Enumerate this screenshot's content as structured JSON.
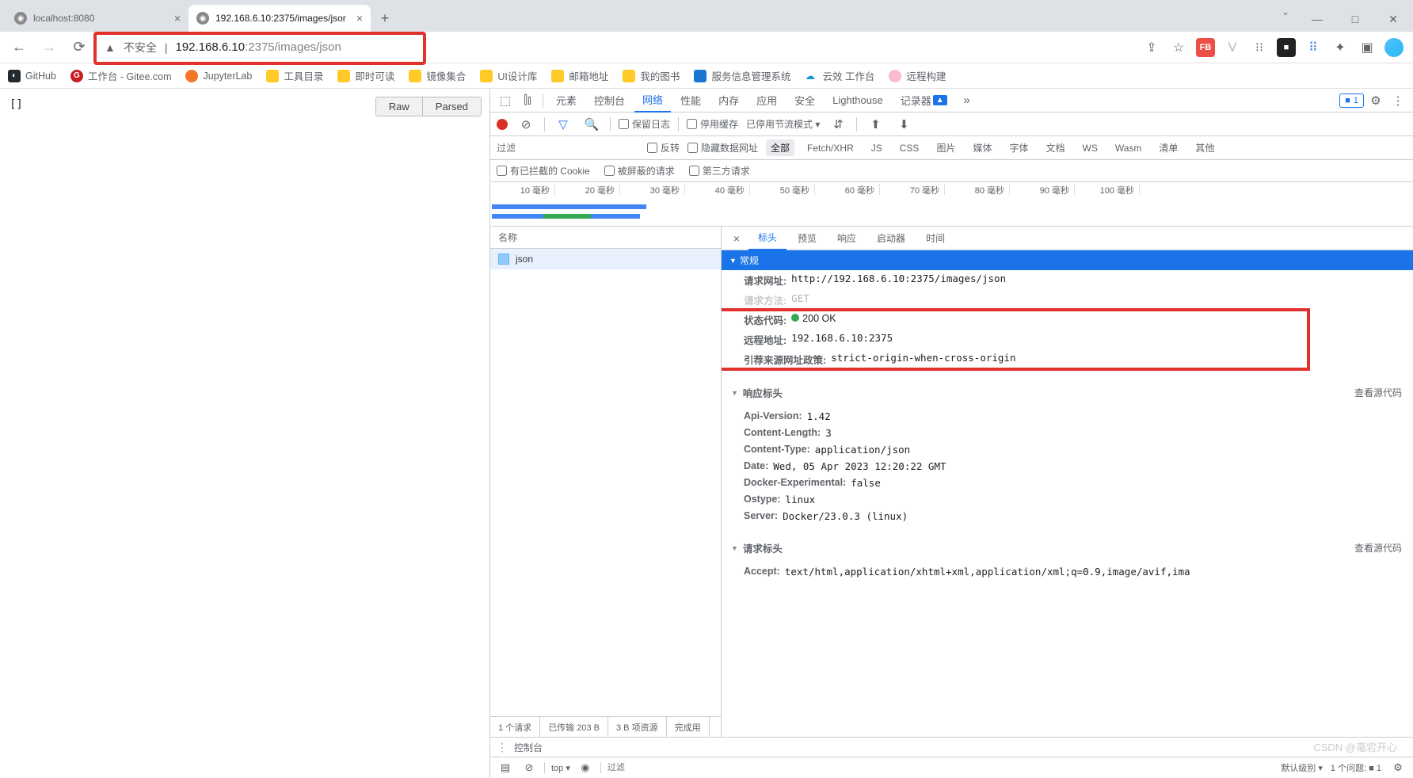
{
  "tabs": [
    {
      "title": "localhost:8080",
      "active": false
    },
    {
      "title": "192.168.6.10:2375/images/jsor",
      "active": true
    }
  ],
  "address": {
    "insecure_label": "不安全",
    "url_prefix": "192.168.6.10",
    "url_port": ":2375",
    "url_path": "/images/json"
  },
  "bookmarks": [
    "GitHub",
    "工作台 - Gitee.com",
    "JupyterLab",
    "工具目录",
    "即时可读",
    "镜像集合",
    "UI设计库",
    "邮箱地址",
    "我的图书",
    "服务信息管理系统",
    "云效 工作台",
    "远程构建"
  ],
  "page_body": "[]",
  "json_buttons": {
    "raw": "Raw",
    "parsed": "Parsed"
  },
  "devtools": {
    "tabs": [
      "元素",
      "控制台",
      "网络",
      "性能",
      "内存",
      "应用",
      "安全",
      "Lighthouse",
      "记录器"
    ],
    "active_tab": "网络",
    "issues_count": "1",
    "net_toolbar": {
      "preserve_log": "保留日志",
      "disable_cache": "停用缓存",
      "throttling": "已停用节流模式"
    },
    "filter_placeholder": "过滤",
    "filter_checks": {
      "invert": "反转",
      "hide_data": "隐藏数据网址"
    },
    "filter_chips": [
      "全部",
      "Fetch/XHR",
      "JS",
      "CSS",
      "图片",
      "媒体",
      "字体",
      "文档",
      "WS",
      "Wasm",
      "清单",
      "其他"
    ],
    "filter_active": "全部",
    "cookie_row": [
      "有已拦截的 Cookie",
      "被屏蔽的请求",
      "第三方请求"
    ],
    "timeline_ticks": [
      "10 毫秒",
      "20 毫秒",
      "30 毫秒",
      "40 毫秒",
      "50 毫秒",
      "60 毫秒",
      "70 毫秒",
      "80 毫秒",
      "90 毫秒",
      "100 毫秒"
    ],
    "req_list": {
      "header": "名称",
      "items": [
        "json"
      ],
      "footer": [
        "1 个请求",
        "已传输 203 B",
        "3 B 项资源",
        "完成用"
      ]
    },
    "detail_tabs": [
      "标头",
      "预览",
      "响应",
      "启动器",
      "时间"
    ],
    "detail_active": "标头",
    "general": {
      "title": "常规",
      "request_url_k": "请求网址:",
      "request_url_v": "http://192.168.6.10:2375/images/json",
      "request_method_k": "请求方法:",
      "request_method_v": "GET",
      "status_k": "状态代码:",
      "status_v": "200 OK",
      "remote_k": "远程地址:",
      "remote_v": "192.168.6.10:2375",
      "referrer_k": "引荐来源网址政策:",
      "referrer_v": "strict-origin-when-cross-origin"
    },
    "response_headers": {
      "title": "响应标头",
      "view_source": "查看源代码",
      "rows": [
        {
          "k": "Api-Version:",
          "v": "1.42"
        },
        {
          "k": "Content-Length:",
          "v": "3"
        },
        {
          "k": "Content-Type:",
          "v": "application/json"
        },
        {
          "k": "Date:",
          "v": "Wed, 05 Apr 2023 12:20:22 GMT"
        },
        {
          "k": "Docker-Experimental:",
          "v": "false"
        },
        {
          "k": "Ostype:",
          "v": "linux"
        },
        {
          "k": "Server:",
          "v": "Docker/23.0.3 (linux)"
        }
      ]
    },
    "request_headers": {
      "title": "请求标头",
      "view_source": "查看源代码",
      "accept_k": "Accept:",
      "accept_v": "text/html,application/xhtml+xml,application/xml;q=0.9,image/avif,ima"
    },
    "console": {
      "title": "控制台",
      "top": "top",
      "filter_placeholder": "过滤",
      "level": "默认级别",
      "issue": "1 个问题:"
    }
  },
  "watermark": "CSDN @毫宕开心"
}
